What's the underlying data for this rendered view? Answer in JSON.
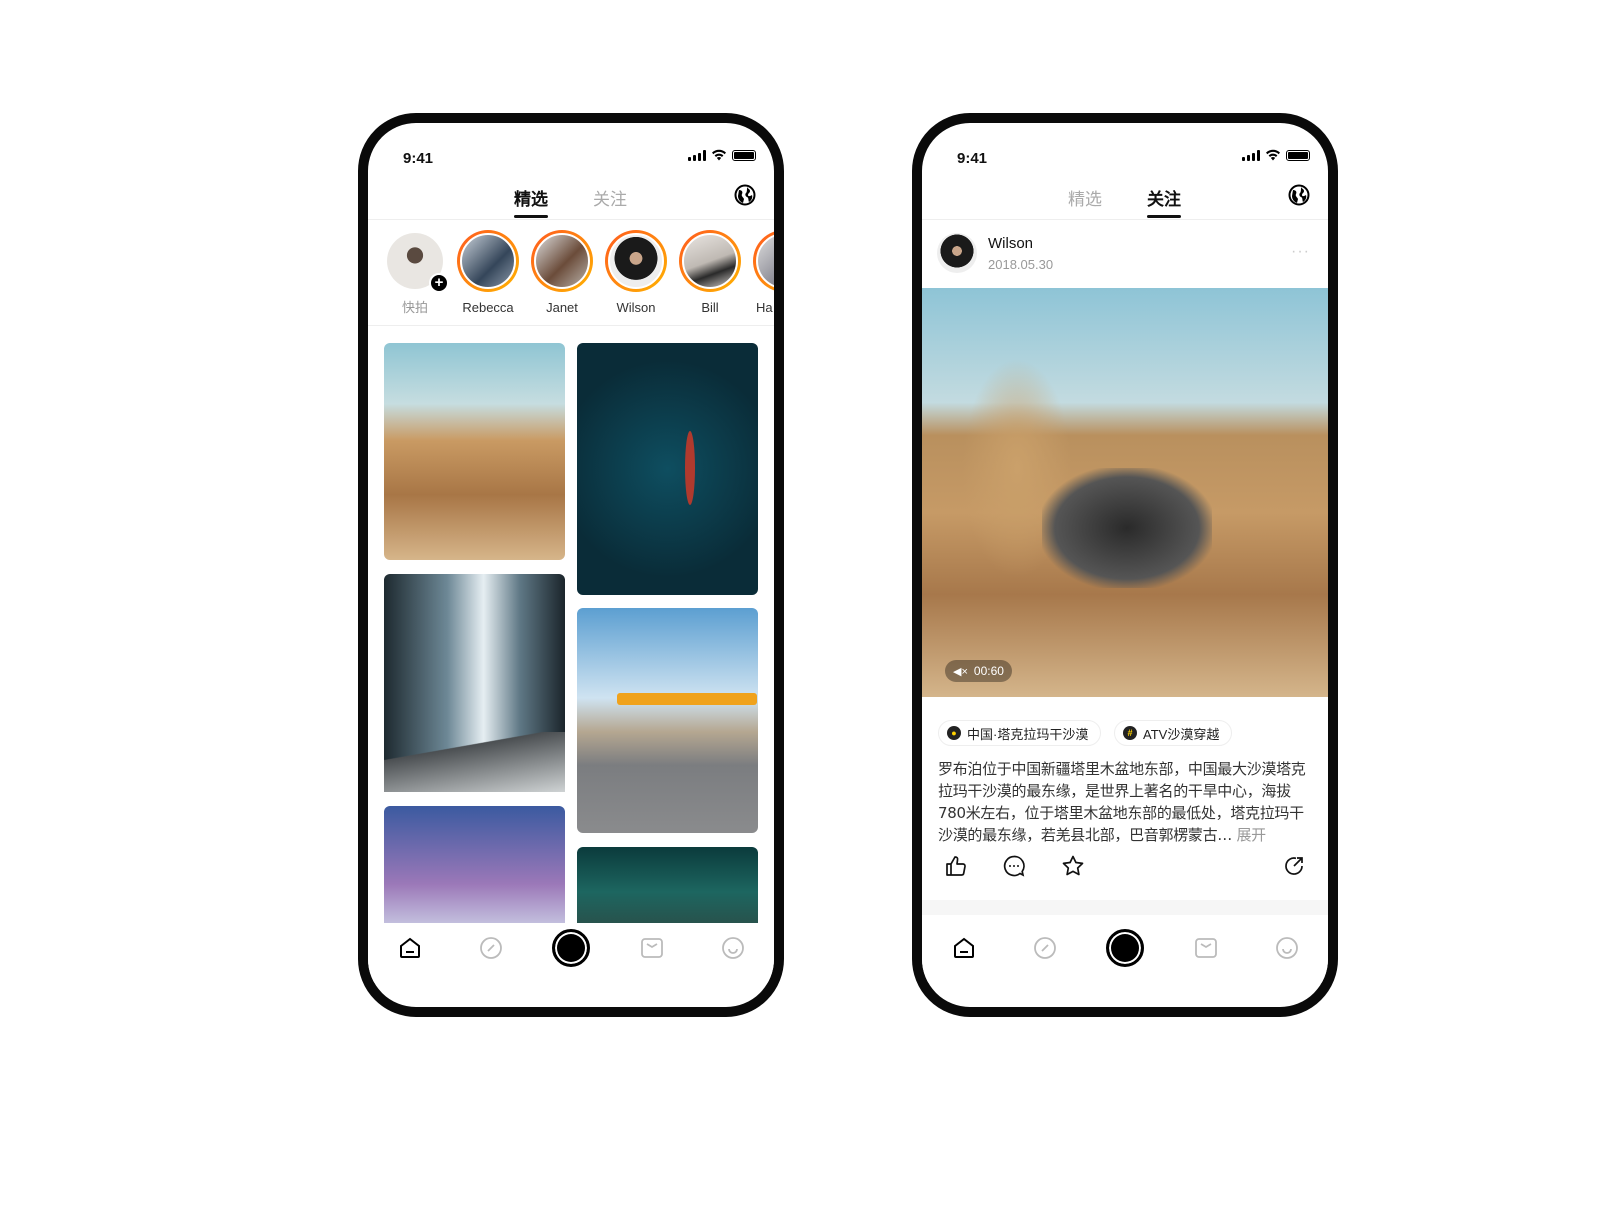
{
  "status": {
    "time": "9:41"
  },
  "tabs": [
    {
      "label": "精选"
    },
    {
      "label": "关注"
    }
  ],
  "stories": [
    {
      "name": "快拍"
    },
    {
      "name": "Rebecca"
    },
    {
      "name": "Janet"
    },
    {
      "name": "Wilson"
    },
    {
      "name": "Bill"
    },
    {
      "name": "Ha"
    }
  ],
  "post": {
    "author": "Wilson",
    "date": "2018.05.30",
    "more": "···",
    "video_duration": "00:60",
    "location_tag": "中国·塔克拉玛干沙漠",
    "topic_tag": "ATV沙漠穿越",
    "topic_symbol": "#",
    "text": "罗布泊位于中国新疆塔里木盆地东部，中国最大沙漠塔克拉玛干沙漠的最东缘，是世界上著名的干旱中心，海拔780米左右，位于塔里木盆地东部的最低处，塔克拉玛干沙漠的最东缘，若羌县北部，巴音郭楞蒙古…",
    "expand": "展开"
  },
  "colors": {
    "story_ring_start": "#ff5a1f",
    "story_ring_end": "#ffb300",
    "tag_icon": "#ffd200"
  },
  "nav_icons": [
    "home-icon",
    "discover-icon",
    "shoot-icon",
    "message-icon",
    "profile-icon"
  ]
}
